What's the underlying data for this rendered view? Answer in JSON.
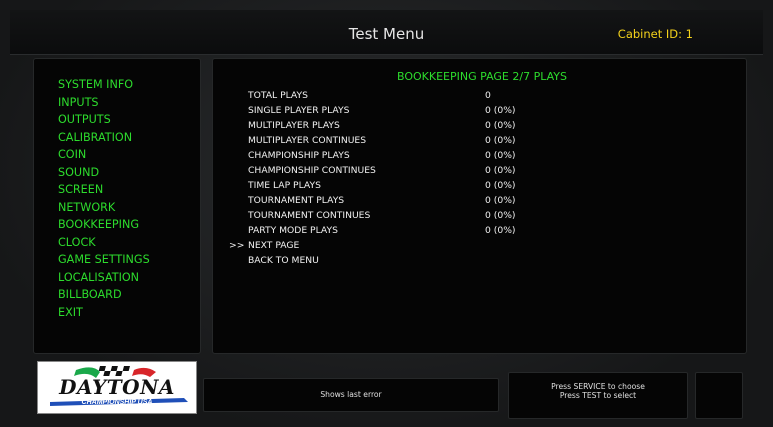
{
  "header": {
    "title": "Test Menu",
    "cabinet_id": "Cabinet ID: 1"
  },
  "menu": {
    "items": [
      {
        "label": "SYSTEM INFO"
      },
      {
        "label": "INPUTS"
      },
      {
        "label": "OUTPUTS"
      },
      {
        "label": "CALIBRATION"
      },
      {
        "label": "COIN"
      },
      {
        "label": "SOUND"
      },
      {
        "label": "SCREEN"
      },
      {
        "label": "NETWORK"
      },
      {
        "label": "BOOKKEEPING"
      },
      {
        "label": "CLOCK"
      },
      {
        "label": "GAME SETTINGS"
      },
      {
        "label": "LOCALISATION"
      },
      {
        "label": "BILLBOARD"
      },
      {
        "label": "EXIT"
      }
    ]
  },
  "bookkeeping": {
    "heading": "BOOKKEEPING PAGE 2/7 PLAYS",
    "rows": [
      {
        "label": "TOTAL PLAYS",
        "value": "0"
      },
      {
        "label": "SINGLE PLAYER PLAYS",
        "value": "0  (0%)"
      },
      {
        "label": "MULTIPLAYER PLAYS",
        "value": "0  (0%)"
      },
      {
        "label": "MULTIPLAYER CONTINUES",
        "value": "0  (0%)"
      },
      {
        "label": "CHAMPIONSHIP PLAYS",
        "value": "0  (0%)"
      },
      {
        "label": "CHAMPIONSHIP CONTINUES",
        "value": "0  (0%)"
      },
      {
        "label": "TIME LAP PLAYS",
        "value": "0  (0%)"
      },
      {
        "label": "TOURNAMENT PLAYS",
        "value": "0  (0%)"
      },
      {
        "label": "TOURNAMENT CONTINUES",
        "value": "0  (0%)"
      },
      {
        "label": "PARTY MODE PLAYS",
        "value": "0  (0%)"
      }
    ],
    "cursor": ">>",
    "actions": [
      {
        "label": "NEXT PAGE"
      },
      {
        "label": "BACK TO MENU"
      }
    ]
  },
  "logo": {
    "name": "DAYTONA",
    "subtitle": "CHAMPIONSHIP USA"
  },
  "footer": {
    "error_text": "Shows last error",
    "instruction_1": "Press SERVICE to choose",
    "instruction_2": "Press TEST to select"
  },
  "colors": {
    "menu_green": "#2ddc2d",
    "cabinet_yellow": "#f4d21b",
    "logo_blue": "#1f4fb8",
    "text_white": "#f2f2f2"
  }
}
